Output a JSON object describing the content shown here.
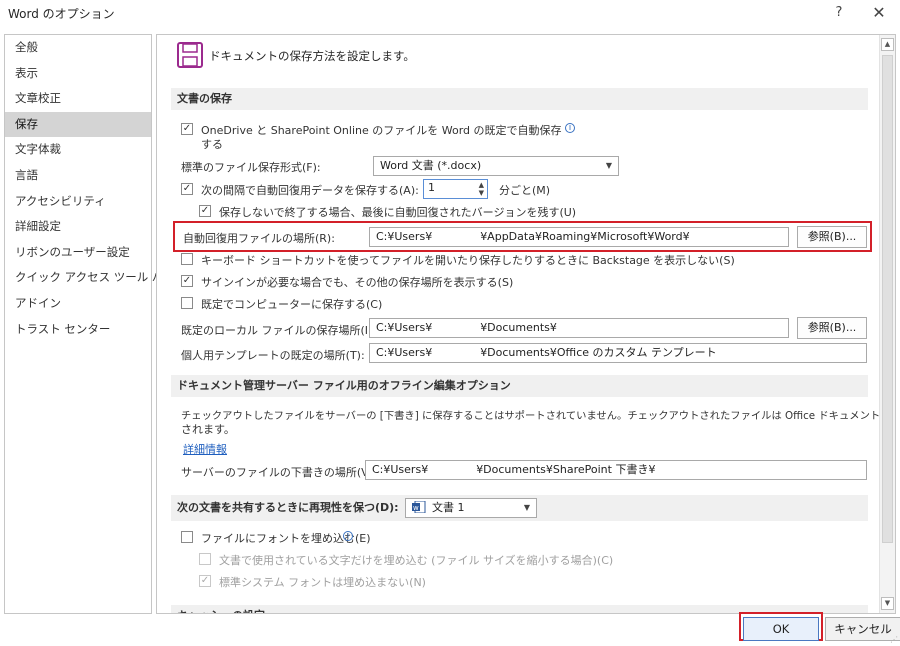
{
  "window": {
    "title": "Word のオプション",
    "help_label": "?",
    "close_label": "✕"
  },
  "sidebar": {
    "items": [
      {
        "label": "全般",
        "selected": false
      },
      {
        "label": "表示",
        "selected": false
      },
      {
        "label": "文章校正",
        "selected": false
      },
      {
        "label": "保存",
        "selected": true
      },
      {
        "label": "文字体裁",
        "selected": false
      },
      {
        "label": "言語",
        "selected": false
      },
      {
        "label": "アクセシビリティ",
        "selected": false
      },
      {
        "label": "詳細設定",
        "selected": false
      },
      {
        "label": "リボンのユーザー設定",
        "selected": false
      },
      {
        "label": "クイック アクセス ツール バー",
        "selected": false
      },
      {
        "label": "アドイン",
        "selected": false
      },
      {
        "label": "トラスト センター",
        "selected": false
      }
    ]
  },
  "header": {
    "icon": "save-icon",
    "text": "ドキュメントの保存方法を設定します。"
  },
  "save_section": {
    "title": "文書の保存",
    "onedrive_autosave": {
      "label_line1": "OneDrive と SharePoint Online のファイルを Word の既定で自動保存",
      "label_line2": "する",
      "checked": true
    },
    "default_format": {
      "label": "標準のファイル保存形式(F):",
      "value": "Word 文書 (*.docx)"
    },
    "autorecover_interval": {
      "label": "次の間隔で自動回復用データを保存する(A):",
      "value": "1",
      "unit": "分ごと(M)",
      "checked": true
    },
    "keep_last_autosaved": {
      "label": "保存しないで終了する場合、最後に自動回復されたバージョンを残す(U)",
      "checked": true
    },
    "autorecover_location": {
      "label": "自動回復用ファイルの場所(R):",
      "path_prefix": "C:¥Users¥",
      "path_suffix": "¥AppData¥Roaming¥Microsoft¥Word¥",
      "browse_label": "参照(B)..."
    },
    "no_backstage": {
      "label": "キーボード ショートカットを使ってファイルを開いたり保存したりするときに Backstage を表示しない(S)",
      "checked": false
    },
    "show_additional_places": {
      "label": "サインインが必要な場合でも、その他の保存場所を表示する(S)",
      "checked": true
    },
    "save_to_computer": {
      "label": "既定でコンピューターに保存する(C)",
      "checked": false
    },
    "default_local_location": {
      "label": "既定のローカル ファイルの保存場所(I):",
      "path_prefix": "C:¥Users¥",
      "path_suffix": "¥Documents¥",
      "browse_label": "参照(B)..."
    },
    "personal_templates": {
      "label": "個人用テンプレートの既定の場所(T):",
      "path_prefix": "C:¥Users¥",
      "path_suffix": "¥Documents¥Office のカスタム テンプレート"
    }
  },
  "offline_section": {
    "title": "ドキュメント管理サーバー ファイル用のオフライン編集オプション",
    "description_line1": "チェックアウトしたファイルをサーバーの [下書き] に保存することはサポートされていません。チェックアウトされたファイルは Office ドキュメント キャッシュに保存",
    "description_line2": "されます。",
    "link": "詳細情報",
    "drafts_location": {
      "label": "サーバーのファイルの下書きの場所(V):",
      "path_prefix": "C:¥Users¥",
      "path_suffix": "¥Documents¥SharePoint 下書き¥"
    }
  },
  "fidelity_section": {
    "title": "次の文書を共有するときに再現性を保つ(D):",
    "document": "文書 1",
    "embed_fonts": {
      "label": "ファイルにフォントを埋め込む(E)",
      "checked": false
    },
    "embed_used_only": {
      "label": "文書で使用されている文字だけを埋め込む (ファイル サイズを縮小する場合)(C)",
      "checked": false
    },
    "no_common_fonts": {
      "label": "標準システム フォントは埋め込まない(N)",
      "checked": true
    }
  },
  "cache_section": {
    "title": "キャッシュの設定"
  },
  "footer": {
    "ok_label": "OK",
    "cancel_label": "キャンセル"
  },
  "colors": {
    "highlight_frame": "#d32029",
    "selected_item": "#d4d4d4",
    "link": "#1f5fbf"
  }
}
